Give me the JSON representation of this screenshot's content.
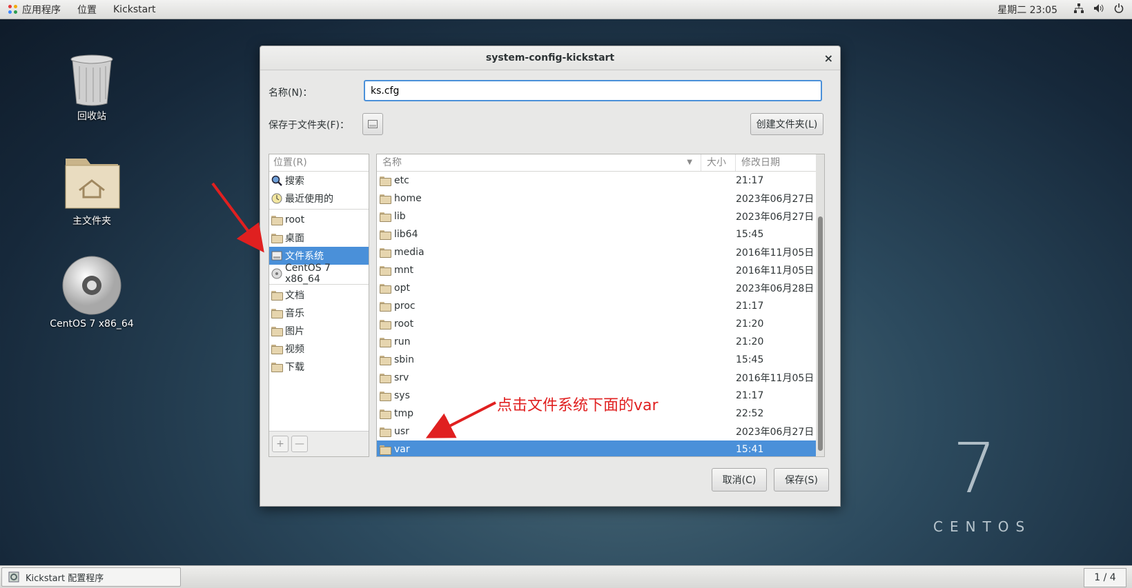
{
  "topbar": {
    "apps": "应用程序",
    "places": "位置",
    "kickstart": "Kickstart",
    "clock": "星期二 23:05"
  },
  "desktop": {
    "trash": "回收站",
    "home": "主文件夹",
    "disc": "CentOS 7 x86_64",
    "brand_number": "7",
    "brand_text": "CENTOS"
  },
  "dialog": {
    "title": "system-config-kickstart",
    "name_label": "名称(N)：",
    "name_value": "ks.cfg",
    "folder_label": "保存于文件夹(F)：",
    "create_folder": "创建文件夹(L)",
    "cancel": "取消(C)",
    "save": "保存(S)"
  },
  "places": {
    "header": "位置(R)",
    "items": [
      {
        "label": "搜索",
        "icon": "search-icon"
      },
      {
        "label": "最近使用的",
        "icon": "recent-icon"
      },
      {
        "label": "root",
        "icon": "home-folder-icon"
      },
      {
        "label": "桌面",
        "icon": "desktop-folder-icon"
      },
      {
        "label": "文件系统",
        "icon": "drive-icon",
        "selected": true
      },
      {
        "label": "CentOS 7 x86_64",
        "icon": "disc-icon"
      },
      {
        "label": "文档",
        "icon": "documents-folder-icon"
      },
      {
        "label": "音乐",
        "icon": "music-folder-icon"
      },
      {
        "label": "图片",
        "icon": "pictures-folder-icon"
      },
      {
        "label": "视频",
        "icon": "videos-folder-icon"
      },
      {
        "label": "下载",
        "icon": "downloads-folder-icon"
      }
    ],
    "add": "+",
    "remove": "—"
  },
  "files": {
    "columns": {
      "name": "名称",
      "size": "大小",
      "modified": "修改日期"
    },
    "rows": [
      {
        "name": "etc",
        "date": "21:17"
      },
      {
        "name": "home",
        "date": "2023年06月27日"
      },
      {
        "name": "lib",
        "date": "2023年06月27日"
      },
      {
        "name": "lib64",
        "date": "15:45"
      },
      {
        "name": "media",
        "date": "2016年11月05日"
      },
      {
        "name": "mnt",
        "date": "2016年11月05日"
      },
      {
        "name": "opt",
        "date": "2023年06月28日"
      },
      {
        "name": "proc",
        "date": "21:17"
      },
      {
        "name": "root",
        "date": "21:20"
      },
      {
        "name": "run",
        "date": "21:20"
      },
      {
        "name": "sbin",
        "date": "15:45"
      },
      {
        "name": "srv",
        "date": "2016年11月05日"
      },
      {
        "name": "sys",
        "date": "21:17"
      },
      {
        "name": "tmp",
        "date": "22:52"
      },
      {
        "name": "usr",
        "date": "2023年06月27日"
      },
      {
        "name": "var",
        "date": "15:41",
        "selected": true
      }
    ]
  },
  "annotation": "点击文件系统下面的var",
  "taskbar": {
    "task": "Kickstart 配置程序",
    "workspace": "1 / 4"
  },
  "colors": {
    "accent": "#4a90d9",
    "annotation": "#e02020"
  }
}
